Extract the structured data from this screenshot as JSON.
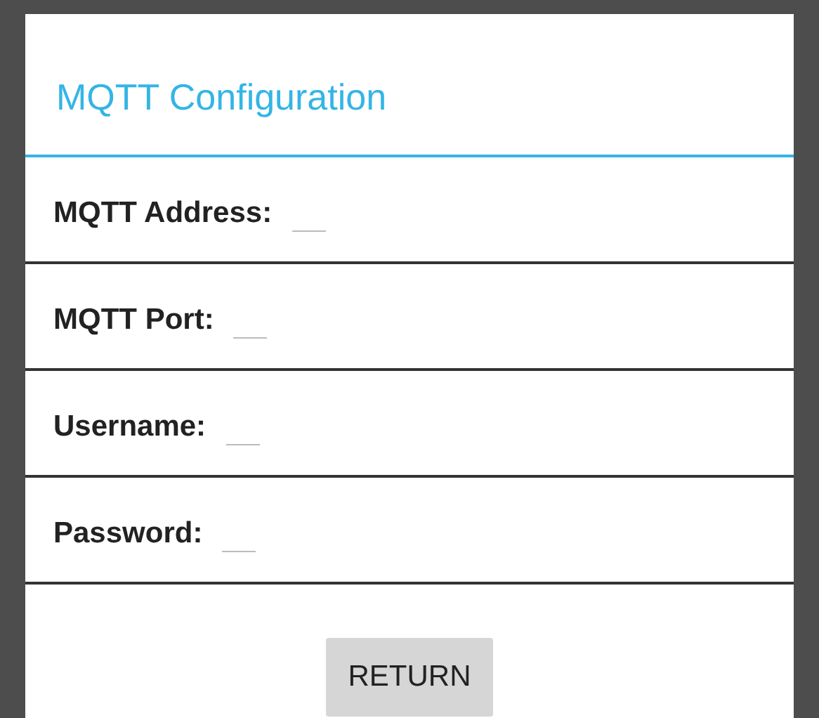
{
  "dialog": {
    "title": "MQTT Configuration"
  },
  "fields": [
    {
      "label": "MQTT Address:"
    },
    {
      "label": "MQTT Port:"
    },
    {
      "label": "Username:"
    },
    {
      "label": "Password:"
    }
  ],
  "buttons": [
    "RETURN"
  ]
}
